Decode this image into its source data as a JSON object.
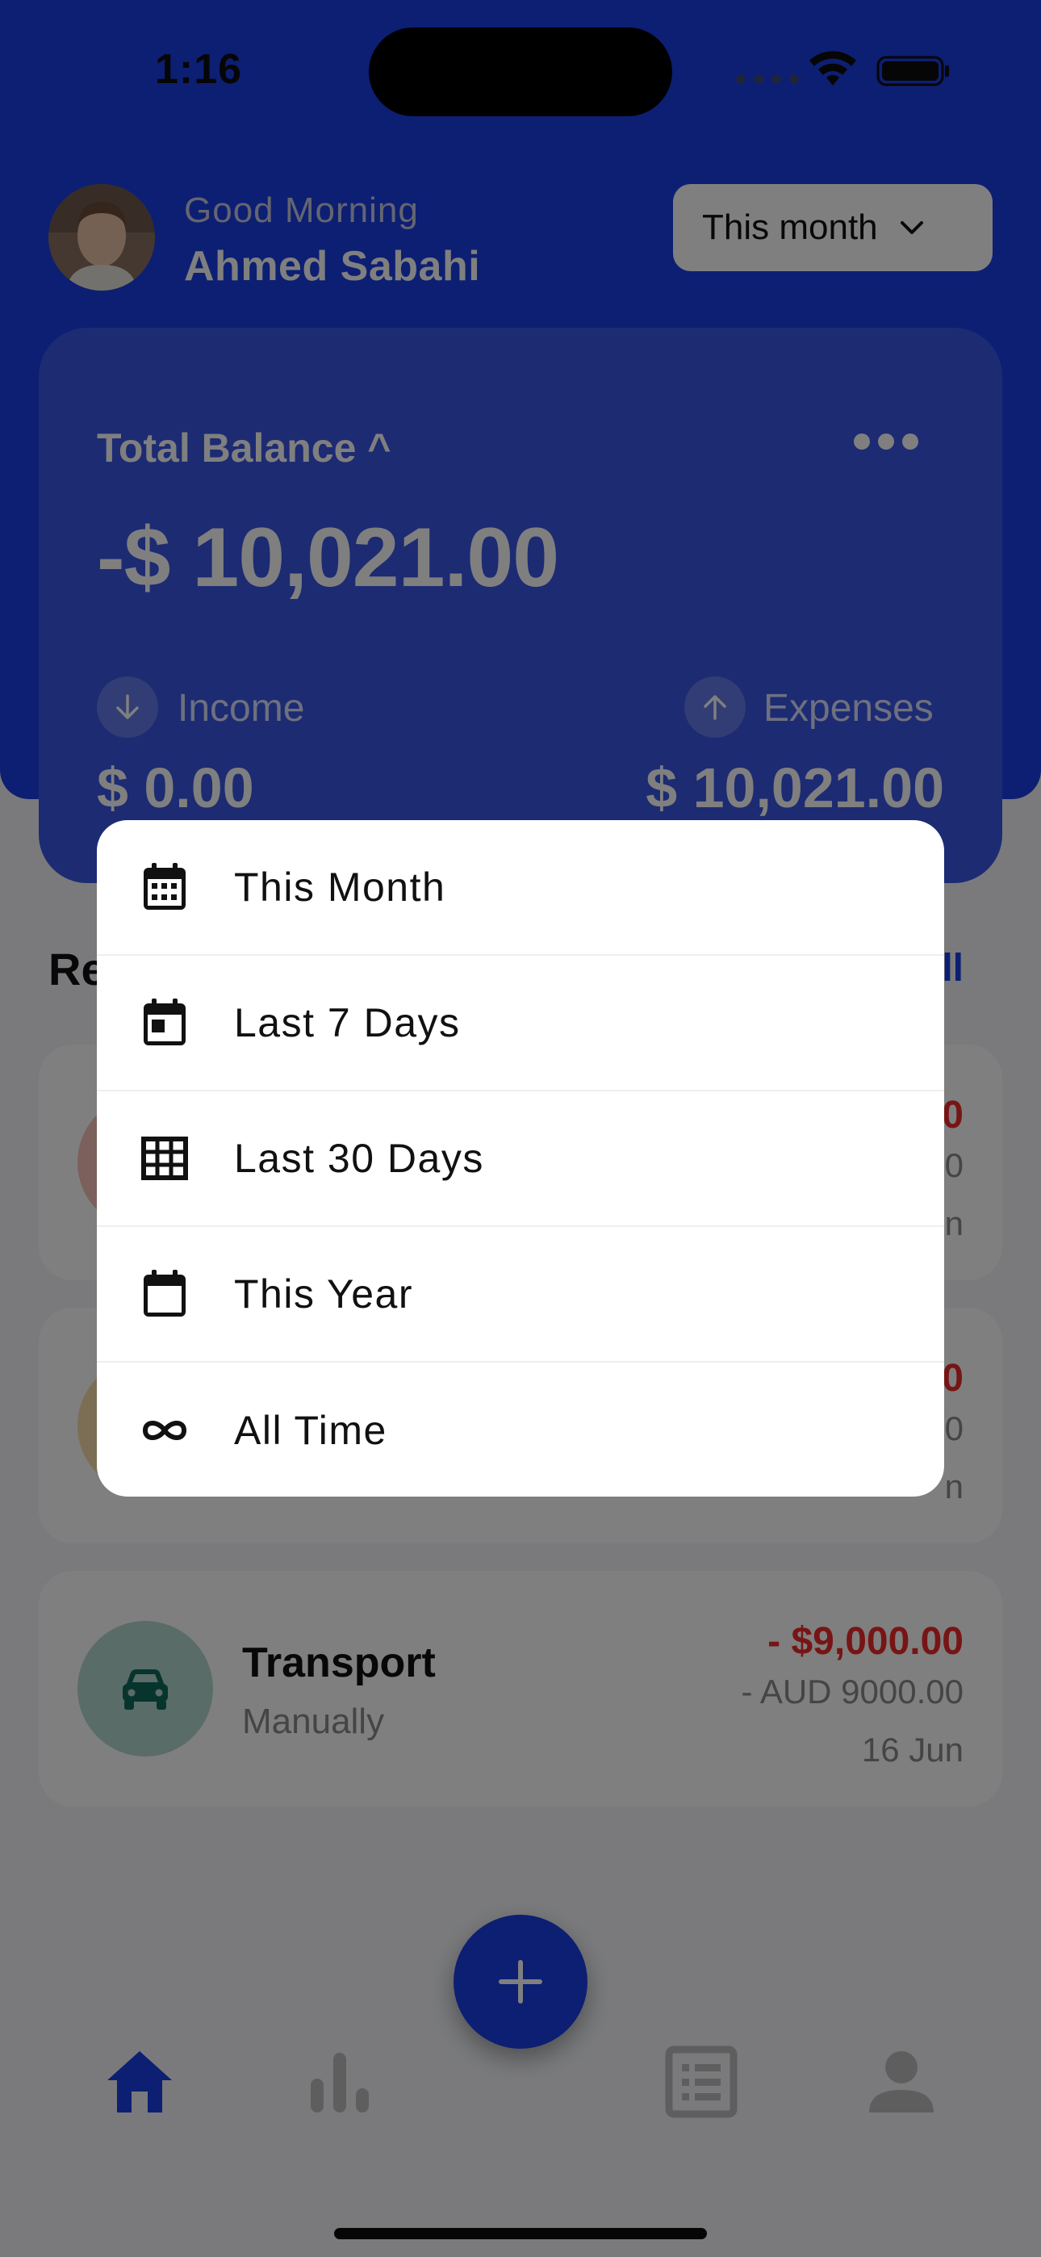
{
  "status_bar": {
    "time": "1:16"
  },
  "header": {
    "greeting": "Good Morning",
    "user_name": "Ahmed Sabahi",
    "period_select": {
      "label": "This month",
      "icon": "chevron-down-icon"
    }
  },
  "balance": {
    "label": "Total Balance ^",
    "amount": "-$ 10,021.00",
    "income": {
      "label": "Income",
      "amount": "$ 0.00",
      "icon": "arrow-down-icon"
    },
    "expenses": {
      "label": "Expenses",
      "amount": "$ 10,021.00",
      "icon": "arrow-up-icon"
    }
  },
  "recent": {
    "title": "Re",
    "see_all": "ll"
  },
  "transactions": [
    {
      "name": "",
      "method": "",
      "amount": "0",
      "sub": "0",
      "date": "n",
      "icon": "category-icon",
      "color": "#f6c1b9"
    },
    {
      "name": "",
      "method": "",
      "amount": "0",
      "sub": "0",
      "date": "n",
      "icon": "category-icon",
      "color": "#f6dca8"
    },
    {
      "name": "Transport",
      "method": "Manually",
      "amount": "- $9,000.00",
      "sub": "- AUD 9000.00",
      "date": "16 Jun",
      "icon": "car-icon",
      "color": "#b5d9d0"
    }
  ],
  "nav": {
    "items": [
      "home-icon",
      "stats-icon",
      "list-icon",
      "profile-icon"
    ],
    "active": "home-icon",
    "fab_icon": "plus-icon"
  },
  "menu": {
    "items": [
      {
        "label": "This Month",
        "icon": "calendar-month-icon"
      },
      {
        "label": "Last 7 Days",
        "icon": "calendar-week-icon"
      },
      {
        "label": "Last 30 Days",
        "icon": "grid-icon"
      },
      {
        "label": "This Year",
        "icon": "calendar-year-icon"
      },
      {
        "label": "All Time",
        "icon": "infinity-icon"
      }
    ]
  },
  "colors": {
    "primary": "#1a3ee6",
    "card": "#3a56e6",
    "expense_red": "#ee2a2a",
    "overlay": "rgba(0,0,0,0.5)"
  }
}
